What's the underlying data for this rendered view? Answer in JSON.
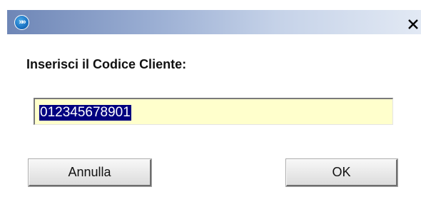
{
  "window": {
    "icon": "app-logo-icon",
    "icon_glyph": "»»",
    "close_glyph": "✕"
  },
  "dialog": {
    "prompt": "Inserisci il Codice Cliente:",
    "input_value": "012345678901",
    "cancel_label": "Annulla",
    "ok_label": "OK"
  },
  "colors": {
    "input_background": "#ffffcc",
    "selection_background": "#000080",
    "titlebar_start": "#6e86b6"
  }
}
